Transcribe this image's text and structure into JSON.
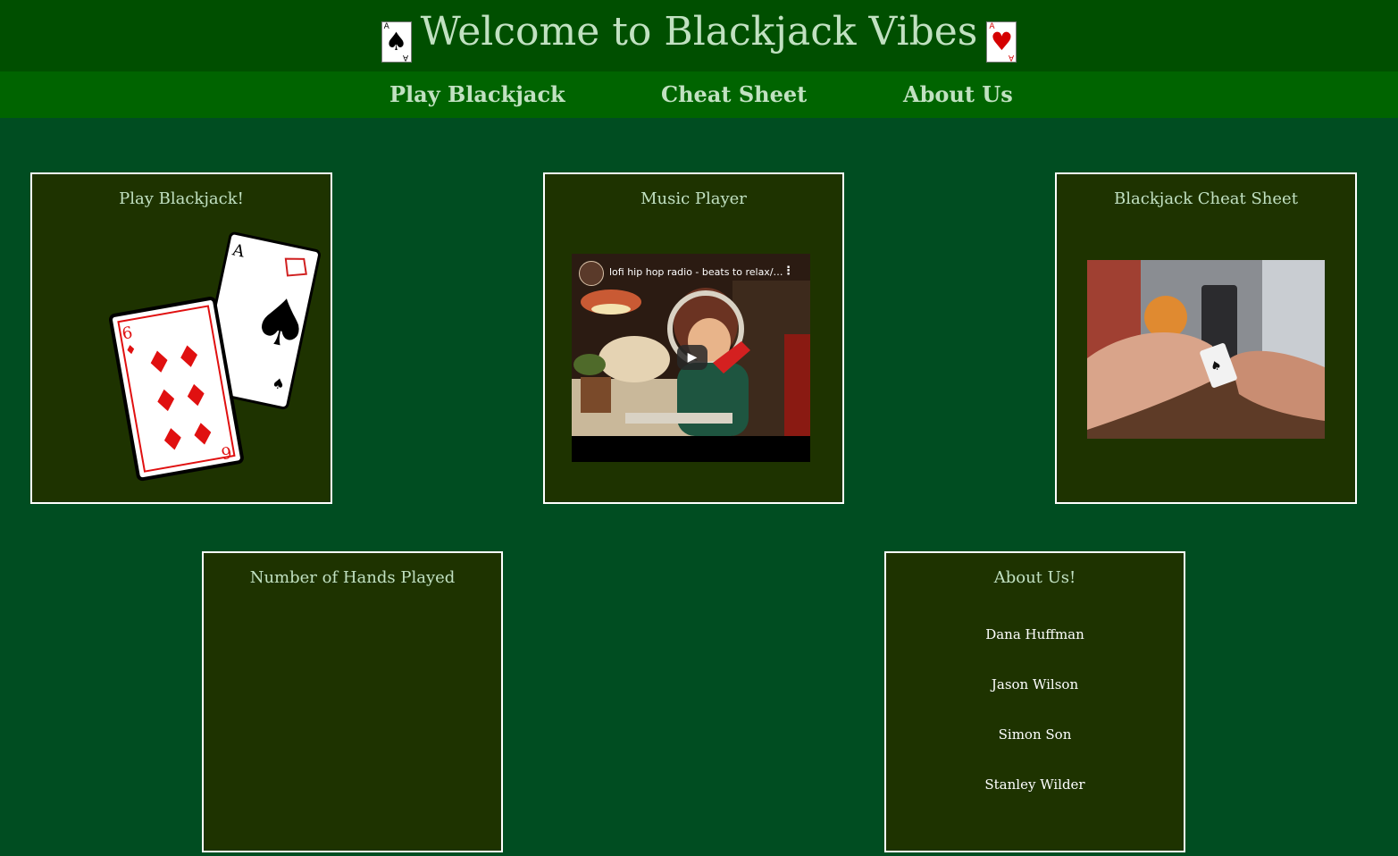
{
  "header": {
    "title": "Welcome to Blackjack Vibes"
  },
  "nav": {
    "items": [
      "Play Blackjack",
      "Cheat Sheet",
      "About Us"
    ]
  },
  "panels": {
    "play": {
      "title": "Play Blackjack!"
    },
    "music": {
      "title": "Music Player",
      "video_title": "lofi hip hop radio - beats to relax/…"
    },
    "cheat": {
      "title": "Blackjack Cheat Sheet"
    },
    "hands": {
      "title": "Number of Hands Played"
    },
    "about": {
      "title": "About Us!",
      "members": [
        "Dana Huffman",
        "Jason Wilson",
        "Simon Son",
        "Stanley Wilder"
      ]
    }
  },
  "colors": {
    "page_background": "#004d21",
    "header_background": "#004f00",
    "nav_background": "#006400",
    "panel_background": "#1e3300",
    "title_text": "#c1e1c1",
    "card_red": "#d40000"
  },
  "icons": {
    "title_left": "ace-of-spades-card-icon",
    "title_right": "ace-of-hearts-card-icon",
    "video_play": "play-icon",
    "video_menu": "more-vert-icon"
  }
}
